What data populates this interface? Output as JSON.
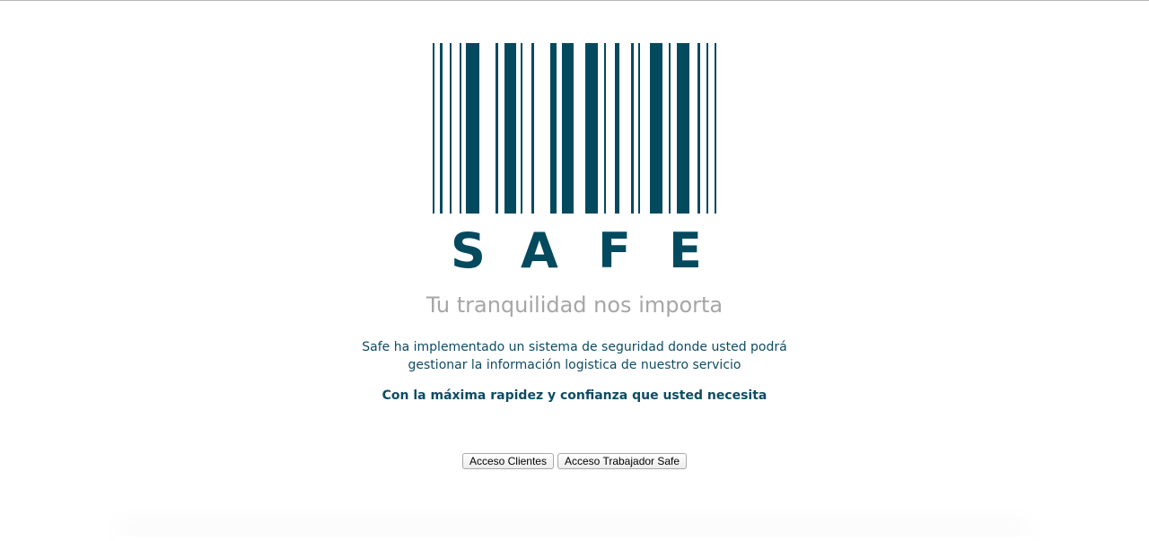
{
  "logo": {
    "icon": "barcode-icon",
    "letters": [
      "S",
      "A",
      "F",
      "E"
    ],
    "color": "#034a5f"
  },
  "tagline": "Tu tranquilidad nos importa",
  "description": {
    "line1": "Safe ha implementado un sistema de seguridad donde usted podrá",
    "line2": "gestionar la información logistica de nuestro servicio"
  },
  "emphasis": "Con la máxima rapidez y confianza que usted necesita",
  "buttons": {
    "clients_label": "Acceso Clientes",
    "worker_label": "Acceso Trabajador Safe"
  },
  "colors": {
    "brand": "#034a5f",
    "text": "#0d4c62",
    "tagline": "#a6a6a6"
  }
}
